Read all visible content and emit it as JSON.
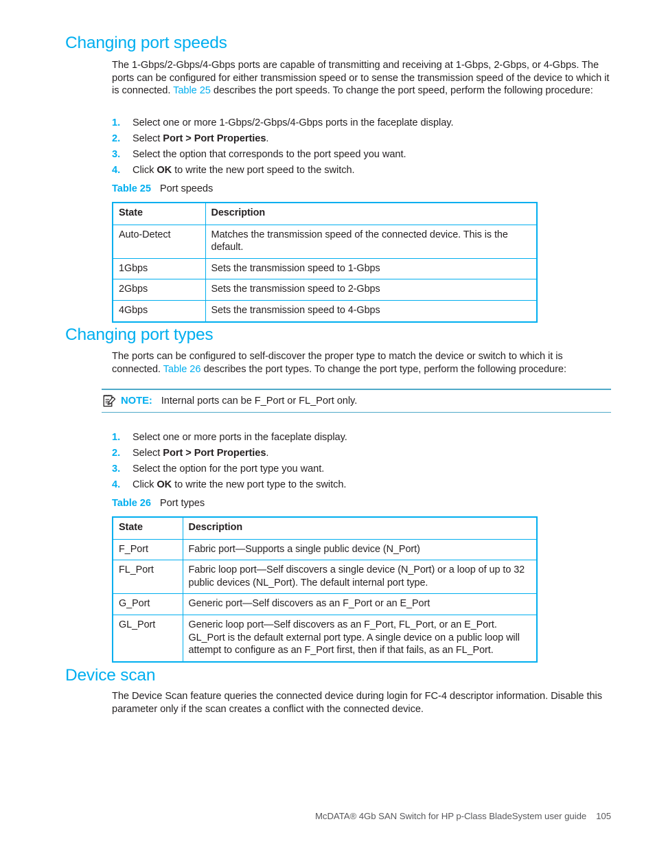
{
  "page": {
    "footer_text": "McDATA® 4Gb SAN Switch for HP p-Class BladeSystem user guide",
    "page_number": "105",
    "accent_color": "#00AEEF",
    "text_color": "#231f20"
  },
  "sections": [
    {
      "heading": "Changing port speeds",
      "paragraph_part1": "The 1-Gbps/2-Gbps/4-Gbps ports are capable of transmitting and receiving at 1-Gbps, 2-Gbps, or 4-Gbps. The ports can be configured for either transmission speed or to sense the transmission speed of the device to which it is connected. ",
      "paragraph_xref": "Table 25",
      "paragraph_part2": " describes the port speeds. To change the port speed, perform the following procedure:",
      "steps": [
        {
          "num": "1.",
          "text_before": "Select one or more 1-Gbps/2-Gbps/4-Gbps ports in the faceplate display.",
          "bold": "",
          "text_after": ""
        },
        {
          "num": "2.",
          "text_before": "Select ",
          "bold": "Port > Port Properties",
          "text_after": "."
        },
        {
          "num": "3.",
          "text_before": "Select the option that corresponds to the port speed you want.",
          "bold": "",
          "text_after": ""
        },
        {
          "num": "4.",
          "text_before": "Click ",
          "bold": "OK",
          "text_after": " to write the new port speed to the switch."
        }
      ]
    },
    {
      "heading": "Changing port types",
      "paragraph_part1": "The ports can be configured to self-discover the proper type to match the device or switch to which it is connected. ",
      "paragraph_xref": "Table 26",
      "paragraph_part2": " describes the port types. To change the port type, perform the following procedure:",
      "steps": [
        {
          "num": "1.",
          "text_before": "Select one or more ports in the faceplate display.",
          "bold": "",
          "text_after": ""
        },
        {
          "num": "2.",
          "text_before": "Select ",
          "bold": "Port > Port Properties",
          "text_after": "."
        },
        {
          "num": "3.",
          "text_before": "Select the option for the port type you want.",
          "bold": "",
          "text_after": ""
        },
        {
          "num": "4.",
          "text_before": "Click ",
          "bold": "OK",
          "text_after": " to write the new port type to the switch."
        }
      ]
    },
    {
      "heading": "Device scan",
      "paragraph_part1": "The Device Scan feature queries the connected device during login for FC-4 descriptor information. Disable this parameter only if the scan creates a conflict with the connected device.",
      "paragraph_xref": "",
      "paragraph_part2": ""
    }
  ],
  "note": {
    "icon": "note-pencil-icon",
    "label": "NOTE:",
    "text": "Internal ports can be F_Port or FL_Port only."
  },
  "table25": {
    "caption_label": "Table 25",
    "caption_text": "Port speeds",
    "headers": [
      "State",
      "Description"
    ],
    "rows": [
      [
        "Auto-Detect",
        "Matches the transmission speed of the connected device. This is the default."
      ],
      [
        "1Gbps",
        "Sets the transmission speed to 1-Gbps"
      ],
      [
        "2Gbps",
        "Sets the transmission speed to 2-Gbps"
      ],
      [
        "4Gbps",
        "Sets the transmission speed to 4-Gbps"
      ]
    ]
  },
  "table26": {
    "caption_label": "Table 26",
    "caption_text": "Port types",
    "headers": [
      "State",
      "Description"
    ],
    "rows": [
      [
        "F_Port",
        "Fabric port—Supports a single public device (N_Port)"
      ],
      [
        "FL_Port",
        "Fabric loop port—Self discovers a single device (N_Port) or a loop of up to 32 public devices (NL_Port). The default internal port type."
      ],
      [
        "G_Port",
        "Generic port—Self discovers as an F_Port or an E_Port"
      ],
      [
        "GL_Port",
        "Generic loop port—Self discovers as an F_Port, FL_Port, or an E_Port. GL_Port is the default external port type. A single device on a public loop will attempt to configure as an F_Port first, then if that fails, as an FL_Port."
      ]
    ]
  }
}
